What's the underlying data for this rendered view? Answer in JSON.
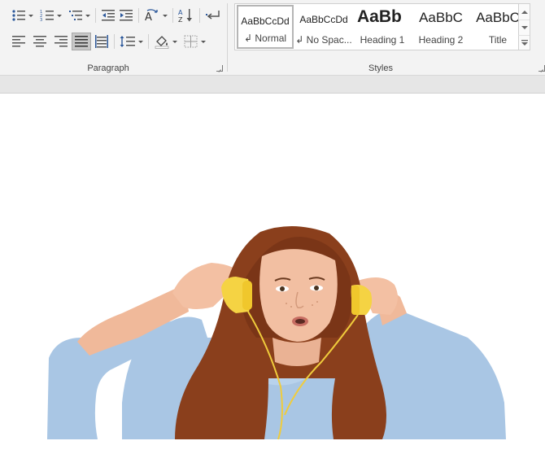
{
  "ribbon": {
    "paragraph_label": "Paragraph",
    "styles_label": "Styles"
  },
  "toolbar": {
    "row1": [
      "bullets",
      "numbering",
      "multilevel-list",
      "decrease-indent",
      "increase-indent",
      "change-case",
      "sort",
      "show-formatting"
    ],
    "row2": [
      "align-left",
      "center",
      "align-right",
      "justify",
      "distributed",
      "line-spacing",
      "shading",
      "borders"
    ],
    "active": "justify"
  },
  "styles": [
    {
      "sample": "AaBbCcDd",
      "name": "↲ Normal",
      "selected": true
    },
    {
      "sample": "AaBbCcDd",
      "name": "↲ No Spac...",
      "selected": false
    },
    {
      "sample": "AaBb",
      "name": "Heading 1",
      "selected": false
    },
    {
      "sample": "AaBbC",
      "name": "Heading 2",
      "selected": false
    },
    {
      "sample": "AaBbC",
      "name": "Title",
      "selected": false
    }
  ],
  "colors": {
    "ribbon_bg": "#f3f3f3",
    "icon_blue": "#2b579a",
    "icon_gray": "#555555",
    "sweater": "#a9c6e4",
    "hair": "#8a3f1c",
    "skin": "#f0b99a",
    "headphones": "#f5d343"
  },
  "image": {
    "description_icon": "photo-of-woman-with-yellow-headphones"
  }
}
